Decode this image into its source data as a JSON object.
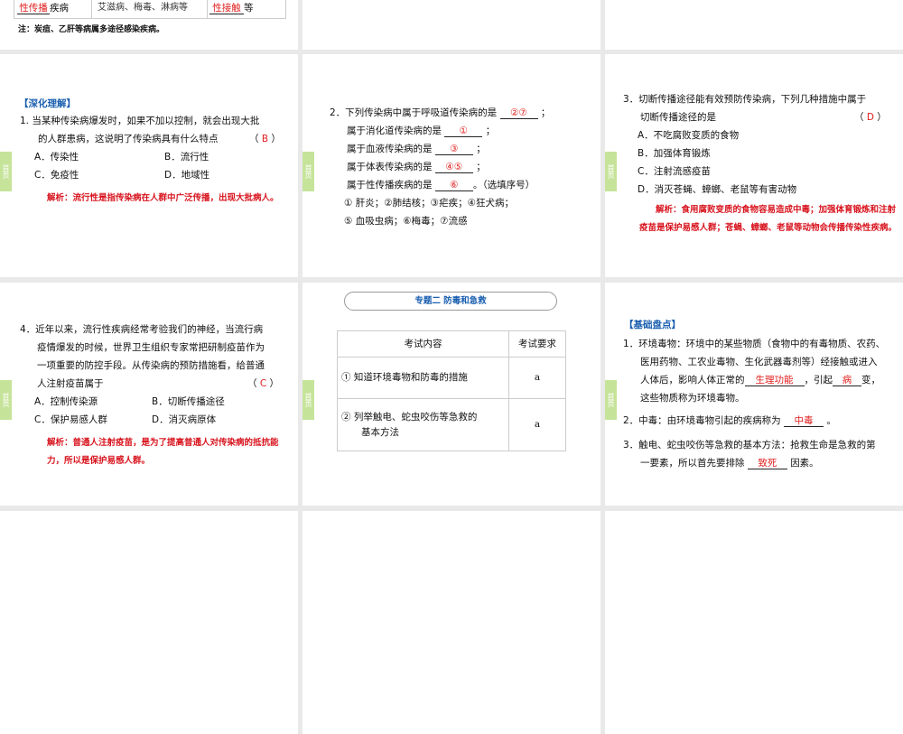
{
  "home_label": "首页",
  "s0": {
    "blank1": "性传播",
    "cell1": "疾病",
    "cell2": "艾滋病、梅毒、淋病等",
    "blank2": "性接触",
    "cell3": "等",
    "note": "注：炭疽、乙肝等病属多途径感染疾病。"
  },
  "s1": {
    "heading": "【深化理解】",
    "q1": "1.  当某种传染病爆发时，如果不加以控制，就会出现大批",
    "q2": "的人群患病，这说明了传染病具有什么特点",
    "ans": "B",
    "a": "A．传染性",
    "b": "B．流行性",
    "c": "C．免疫性",
    "d": "D．地域性",
    "analysis": "解析：流行性是指传染病在人群中广泛传播，出现大批病人。"
  },
  "s2": {
    "l1": "2．下列传染病中属于呼吸道传染病的是",
    "a1": "②⑦",
    "l2": "属于消化道传染病的是",
    "a2": "①",
    "l3": "属于血液传染病的是",
    "a3": "③",
    "l4": "属于体表传染病的是",
    "a4": "④⑤",
    "l5": "属于性传播疾病的是",
    "a5": "⑥",
    "l5end": "。（选填序号）",
    "semi": "；",
    "o1": "① 肝炎；②肺结核；③疟疾；④狂犬病；",
    "o2": "⑤ 血吸虫病；⑥梅毒；⑦流感"
  },
  "s3": {
    "q1": "3．切断传播途径能有效预防传染病，下列几种措施中属于",
    "q2": "切断传播途径的是",
    "ans": "D",
    "a": "A．不吃腐败变质的食物",
    "b": "B．加强体育锻炼",
    "c": "C．注射流感疫苗",
    "d": "D．消灭苍蝇、蟑螂、老鼠等有害动物",
    "analysis": "解析：食用腐败变质的食物容易造成中毒；加强体育锻炼和注射疫苗是保护易感人群；苍蝇、蟑螂、老鼠等动物会传播传染性疾病。"
  },
  "s4": {
    "q1": "4．近年以来，流行性疾病经常考验我们的神经，当流行病",
    "q2": "疫情爆发的时候，世界卫生组织专家常把研制疫苗作为",
    "q3": "一项重要的防控手段。从传染病的预防措施看，给普通",
    "q4": "人注射疫苗属于",
    "ans": "C",
    "a": "A．控制传染源",
    "b": "B．切断传播途径",
    "c": "C．保护易感人群",
    "d": "D．消灭病原体",
    "analysis": "解析：普通人注射疫苗，是为了提高普通人对传染病的抵抗能力，所以是保护易感人群。"
  },
  "s5": {
    "title": "专题二  防毒和急救",
    "h1": "考试内容",
    "h2": "考试要求",
    "r1": "① 知道环境毒物和防毒的措施",
    "r1v": "a",
    "r2a": "② 列举触电、蛇虫咬伤等急救的",
    "r2b": "基本方法",
    "r2v": "a"
  },
  "s6": {
    "heading": "【基础盘点】",
    "p1a": "1．环境毒物：环境中的某些物质（食物中的有毒物质、农药、",
    "p1b": "医用药物、工农业毒物、生化武器毒剂等）经接触或进入",
    "p1c": "人体后，影响人体正常的",
    "b1": "生理功能",
    "p1d": "，引起",
    "b2": "病",
    "p1e": "变，",
    "p1f": "这些物质称为环境毒物。",
    "p2": "2．中毒：由环境毒物引起的疾病称为",
    "b3": "中毒",
    "p2e": "。",
    "p3a": "3．触电、蛇虫咬伤等急救的基本方法：抢救生命是急救的第",
    "p3b": "一要素，所以首先要排除",
    "b4": "致死",
    "p3c": "因素。"
  }
}
